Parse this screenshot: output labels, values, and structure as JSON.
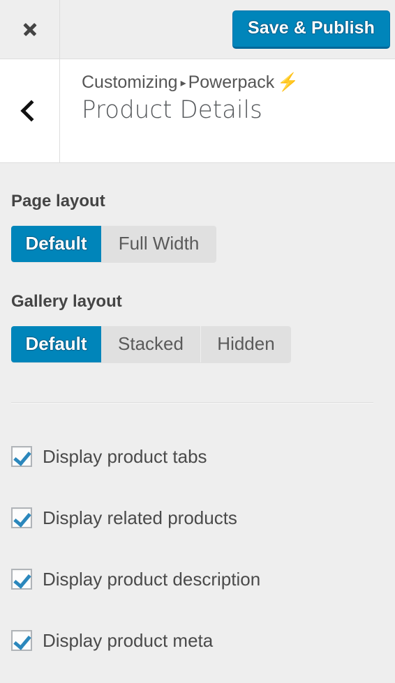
{
  "topbar": {
    "close_icon": "close-icon",
    "save_label": "Save & Publish",
    "accent_color": "#0085ba",
    "background": "#eeeeee"
  },
  "panel_header": {
    "back_icon": "chevron-left-icon",
    "breadcrumb": {
      "root": "Customizing",
      "separator": "▸",
      "parent": "Powerpack",
      "badge_icon": "lightning-bolt-icon",
      "badge_glyph": "⚡"
    },
    "title": "Product Details"
  },
  "sections": {
    "page_layout": {
      "label": "Page layout",
      "options": [
        {
          "label": "Default",
          "selected": true
        },
        {
          "label": "Full Width",
          "selected": false
        }
      ]
    },
    "gallery_layout": {
      "label": "Gallery layout",
      "options": [
        {
          "label": "Default",
          "selected": true
        },
        {
          "label": "Stacked",
          "selected": false
        },
        {
          "label": "Hidden",
          "selected": false
        }
      ]
    },
    "toggles": [
      {
        "label": "Display product tabs",
        "checked": true
      },
      {
        "label": "Display related products",
        "checked": true
      },
      {
        "label": "Display product description",
        "checked": true
      },
      {
        "label": "Display product meta",
        "checked": true
      }
    ]
  },
  "colors": {
    "accent": "#0085ba",
    "accent_dark": "#006799",
    "panel_background": "#eeeeee",
    "header_background": "#ffffff",
    "checkmark": "#2b87bc",
    "bolt": "#f5a623",
    "text": "#444444"
  }
}
